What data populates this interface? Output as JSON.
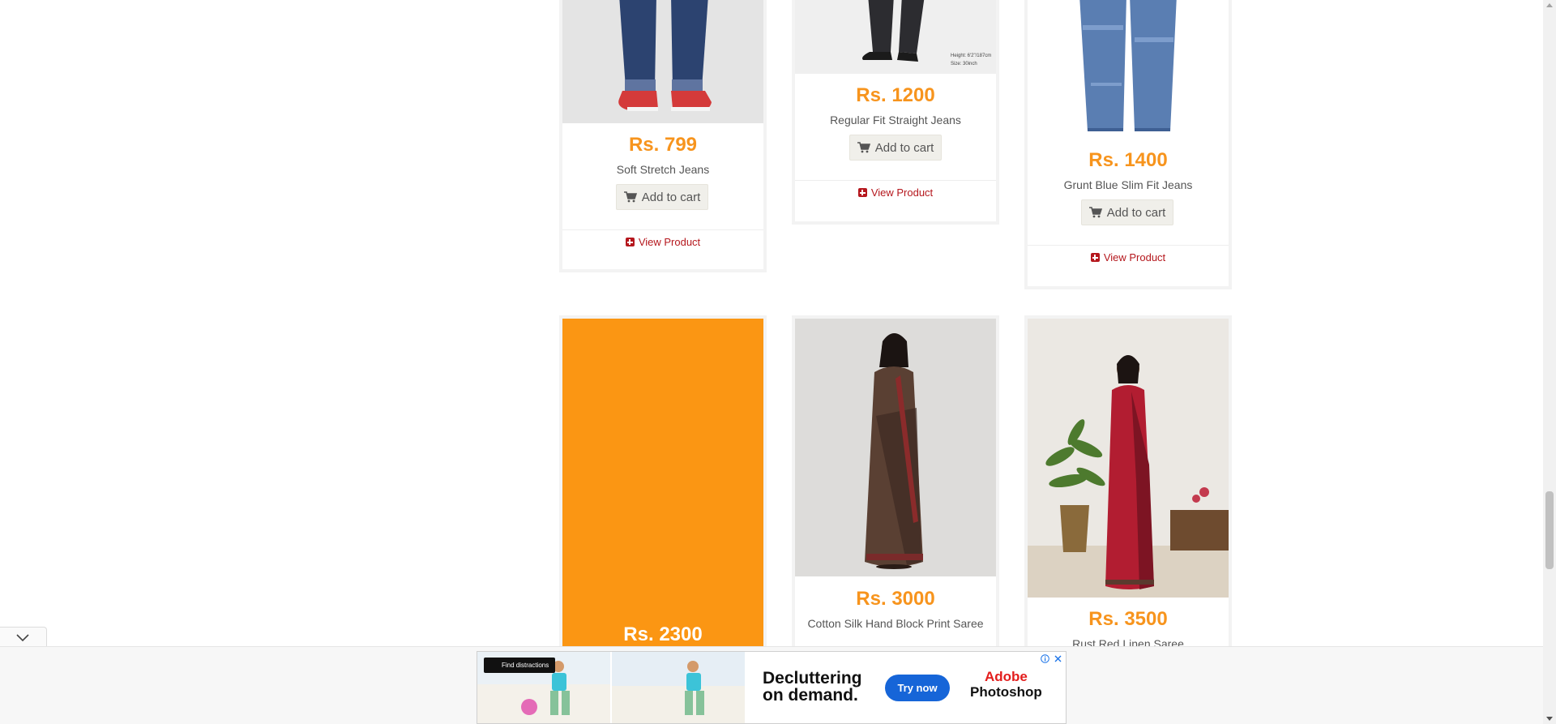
{
  "products": [
    {
      "price": "Rs. 799",
      "name": "Soft Stretch Jeans",
      "cart_label": "Add to cart",
      "view_label": "View Product"
    },
    {
      "price": "Rs. 1200",
      "name": "Regular Fit Straight Jeans",
      "cart_label": "Add to cart",
      "view_label": "View Product",
      "image_note": "Height: 6'2\"/187cm\nSize: 30inch"
    },
    {
      "price": "Rs. 1400",
      "name": "Grunt Blue Slim Fit Jeans",
      "cart_label": "Add to cart",
      "view_label": "View Product"
    },
    {
      "price": "Rs. 2300",
      "name": ""
    },
    {
      "price": "Rs. 3000",
      "name": "Cotton Silk Hand Block Print Saree"
    },
    {
      "price": "Rs. 3500",
      "name": "Rust Red Linen Saree"
    }
  ],
  "colors": {
    "price": "#f7941d",
    "view_link": "#b5171d",
    "placeholder_image": "#fb9613",
    "ad_button": "#1665d8",
    "adobe_red": "#e31d1c"
  },
  "ad": {
    "tooltip": "Find distractions",
    "headline_line1": "Decluttering",
    "headline_line2": "on demand.",
    "cta": "Try now",
    "brand_line1": "Adobe",
    "brand_line2": "Photoshop"
  },
  "icons": [
    "cart-icon",
    "plus-square-icon",
    "chevron-down-icon",
    "ad-info-icon",
    "close-icon"
  ]
}
